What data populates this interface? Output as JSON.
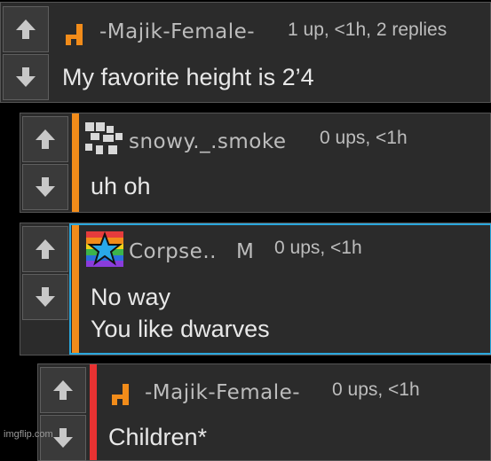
{
  "comments": [
    {
      "username": "-Majik-Female-",
      "meta": "1 up, <1h, 2 replies",
      "text": [
        "My favorite height is 2’4"
      ],
      "avatar": "orange-d-logo-icon"
    },
    {
      "username": "snowy._.smoke",
      "meta": "0 ups, <1h",
      "text": [
        "uh oh"
      ],
      "stripe_color": "#f28c1a",
      "avatar": "pixel-pattern-avatar-icon"
    },
    {
      "username": "Corpse..",
      "flair": "M",
      "meta": "0 ups, <1h",
      "text": [
        "No way",
        "You like dwarves"
      ],
      "stripe_color": "#f28c1a",
      "highlight_color": "#2aa7dc",
      "avatar": "rainbow-star-avatar-icon"
    },
    {
      "username": "-Majik-Female-",
      "meta": "0 ups, <1h",
      "text": [
        "Children*"
      ],
      "stripe_color": "#e83232",
      "avatar": "orange-d-logo-icon"
    }
  ],
  "colors": {
    "accent_orange": "#f28c1a",
    "reply_red": "#e83232",
    "highlight_blue": "#2aa7dc"
  },
  "watermark": "imgflip.com"
}
